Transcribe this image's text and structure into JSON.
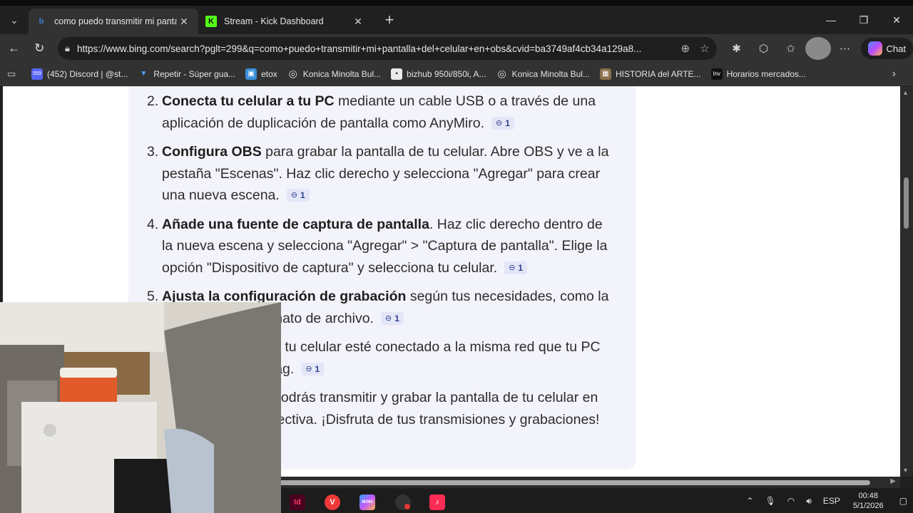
{
  "browser": {
    "tabs": [
      {
        "title": "como puedo transmitir mi pantalla",
        "favicon": "bing-icon",
        "active": true
      },
      {
        "title": "Stream - Kick Dashboard",
        "favicon": "kick-icon",
        "active": false
      }
    ],
    "url": "https://www.bing.com/search?pglt=299&q=como+puedo+transmitir+mi+pantalla+del+celular+en+obs&cvid=ba3749af4cb34a129a8...",
    "chat_label": "Chat",
    "favorites": [
      {
        "label": "(452) Discord | @st...",
        "icon": "discord-icon",
        "badge": "559"
      },
      {
        "label": "Repetir - Súper gua...",
        "icon": "bookmark-icon"
      },
      {
        "label": "etox",
        "icon": "bag-icon"
      },
      {
        "label": "Konica Minolta Bul...",
        "icon": "globe-icon"
      },
      {
        "label": "bizhub 950i/850i, A...",
        "icon": "doc-icon"
      },
      {
        "label": "Konica Minolta Bul...",
        "icon": "globe-icon"
      },
      {
        "label": "HISTORIA del ARTE...",
        "icon": "image-icon"
      },
      {
        "label": "Horarios mercados...",
        "icon": "inv-icon",
        "badge": "Inv"
      }
    ]
  },
  "answer": {
    "steps": [
      {
        "num": "2.",
        "bold": "Conecta tu celular a tu PC",
        "text": " mediante un cable USB o a través de una aplicación de duplicación de pantalla como AnyMiro.",
        "cite": "1"
      },
      {
        "num": "3.",
        "bold": "Configura OBS",
        "text": " para grabar la pantalla de tu celular. Abre OBS y ve a la pestaña \"Escenas\". Haz clic derecho y selecciona \"Agregar\" para crear una nueva escena.",
        "cite": "1"
      },
      {
        "num": "4.",
        "bold": "Añade una fuente de captura de pantalla",
        "text": ". Haz clic derecho dentro de la nueva escena y selecciona \"Agregar\" > \"Captura de pantalla\". Elige la opción \"Dispositivo de captura\" y selecciona tu celular.",
        "cite": "1"
      },
      {
        "num": "5.",
        "bold": "Ajusta la configuración de grabación",
        "text": " según tus necesidades, como la resolución y el formato de archivo.",
        "cite": "1"
      },
      {
        "num": "",
        "bold": "",
        "text": "y asegúrate de que tu celular esté conectado a la misma red que tu PC para minimizar el lag.",
        "cite": "1"
      },
      {
        "num": "",
        "bold": "",
        "text": "Con estos pasos, podrás transmitir y grabar la pantalla de tu celular en OBS de manera efectiva. ¡Disfruta de tus transmisiones y grabaciones!",
        "cite": ""
      }
    ]
  },
  "taskbar": {
    "apps": [
      {
        "label": "Id",
        "color": "#49021f",
        "fg": "#ff3366"
      },
      {
        "label": "V",
        "color": "#ef3939",
        "fg": "#ffffff"
      },
      {
        "label": "M365",
        "color": "#3a6bd8",
        "fg": "#ffffff"
      },
      {
        "label": "",
        "color": "#333333",
        "fg": "#ffffff"
      },
      {
        "label": "♪",
        "color": "#111111",
        "fg": "#ff2d55"
      }
    ],
    "language": "ESP",
    "time": "00:48",
    "date": "5/1/2026"
  }
}
